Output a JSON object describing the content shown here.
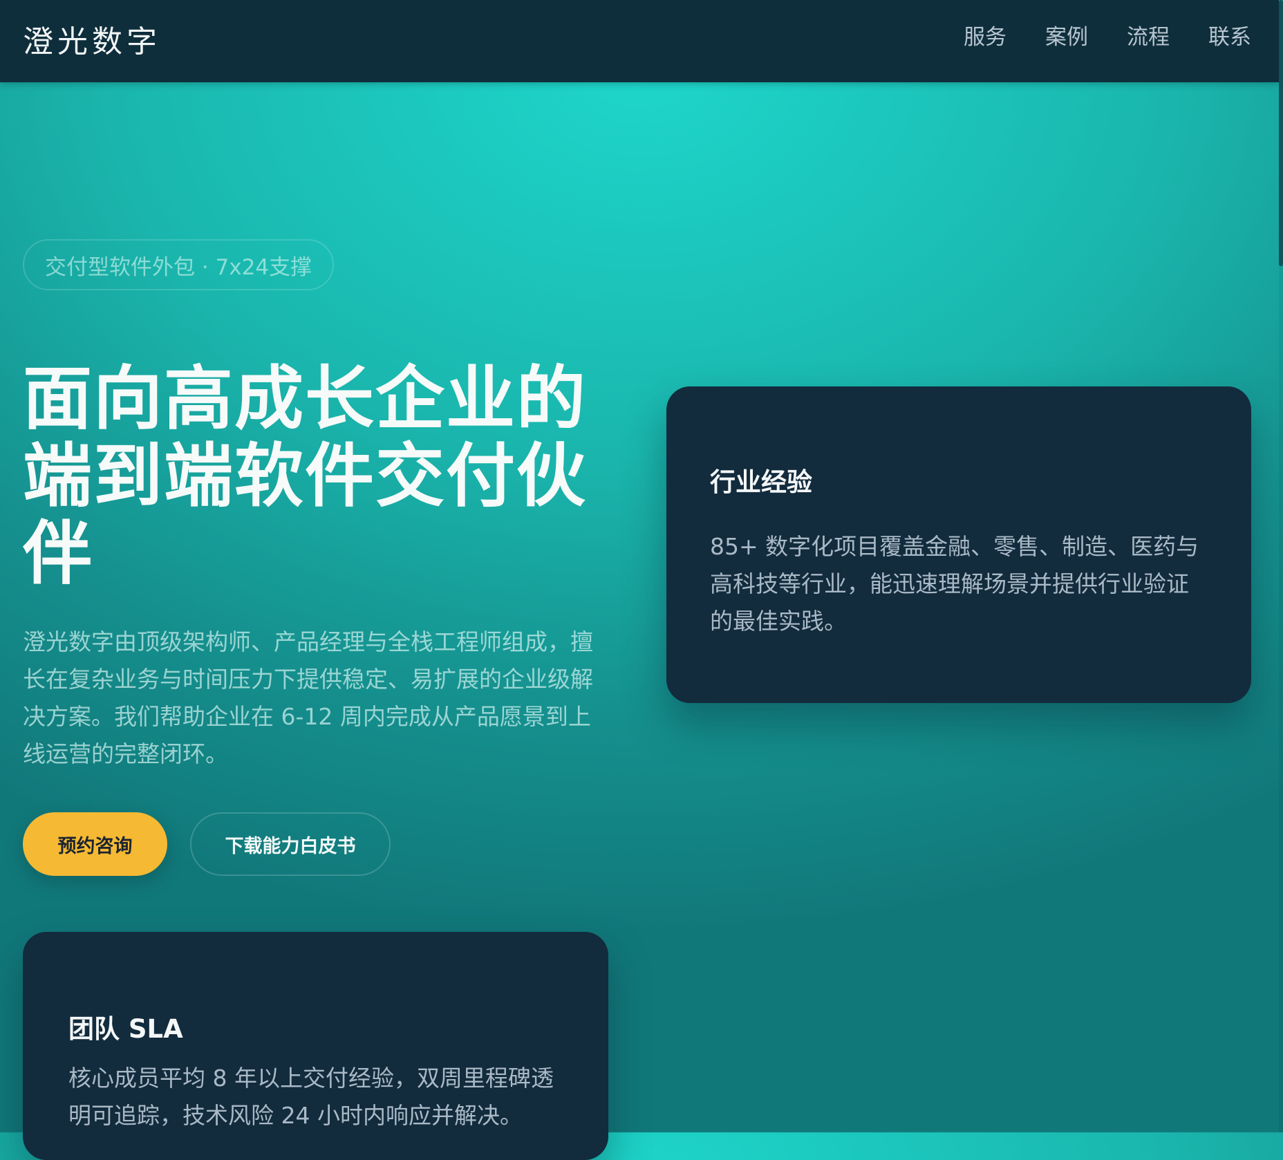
{
  "brand": {
    "name": "澄光数字"
  },
  "nav": {
    "items": [
      {
        "label": "服务"
      },
      {
        "label": "案例"
      },
      {
        "label": "流程"
      },
      {
        "label": "联系"
      }
    ]
  },
  "hero": {
    "badge": "交付型软件外包 · 7x24支撑",
    "title": "面向高成长企业的端到端软件交付伙伴",
    "description": "澄光数字由顶级架构师、产品经理与全栈工程师组成，擅长在复杂业务与时间压力下提供稳定、易扩展的企业级解决方案。我们帮助企业在 6-12 周内完成从产品愿景到上线运营的完整闭环。",
    "primary_button": "预约咨询",
    "secondary_button": "下载能力白皮书"
  },
  "cards": {
    "industry": {
      "title": "行业经验",
      "body": "85+ 数字化项目覆盖金融、零售、制造、医药与高科技等行业，能迅速理解场景并提供行业验证的最佳实践。"
    },
    "sla": {
      "title": "团队 SLA",
      "body": "核心成员平均 8 年以上交付经验，双周里程碑透明可追踪，技术风险 24 小时内响应并解决。"
    }
  },
  "colors": {
    "navbar_bg": "#0f2e3c",
    "hero_gradient_top": "#1ed6ca",
    "hero_gradient_bottom": "#11787a",
    "card_bg": "#122b3d",
    "accent_button": "#f5b933"
  }
}
